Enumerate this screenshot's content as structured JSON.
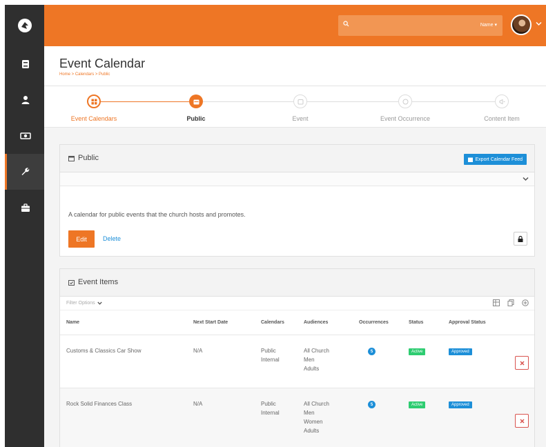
{
  "colors": {
    "brand": "#ee7625",
    "sidebar": "#2f2f2f",
    "link": "#1d8fd8",
    "active_badge": "#2ecc71",
    "approved_badge": "#1d8fd8",
    "danger": "#d9534f"
  },
  "sidebar": {
    "logo_icon": "rock-logo-icon",
    "items": [
      {
        "icon": "book-icon"
      },
      {
        "icon": "person-icon"
      },
      {
        "icon": "money-icon"
      },
      {
        "icon": "wrench-icon",
        "active": true
      },
      {
        "icon": "briefcase-icon"
      }
    ]
  },
  "header": {
    "search_icon": "search-icon",
    "search_scope": "Name ▾"
  },
  "page": {
    "title": "Event Calendar",
    "breadcrumb": "Home > Calendars > Public"
  },
  "wizard": {
    "steps": [
      {
        "label": "Event Calendars",
        "state": "completed",
        "icon": "calendars-icon"
      },
      {
        "label": "Public",
        "state": "current",
        "icon": "calendar-icon"
      },
      {
        "label": "Event",
        "state": "upcoming",
        "icon": "event-icon"
      },
      {
        "label": "Event Occurrence",
        "state": "upcoming",
        "icon": "occurrence-icon"
      },
      {
        "label": "Content Item",
        "state": "upcoming",
        "icon": "megaphone-icon"
      }
    ]
  },
  "calendar_panel": {
    "title": "Public",
    "export_label": "Export Calendar Feed",
    "description": "A calendar for public events that the church hosts and promotes.",
    "edit_label": "Edit",
    "delete_label": "Delete"
  },
  "event_items": {
    "title": "Event Items",
    "filter_label": "Filter Options",
    "columns": [
      "Name",
      "Next Start Date",
      "Calendars",
      "Audiences",
      "Occurrences",
      "Status",
      "Approval Status"
    ],
    "rows": [
      {
        "name": "Customs & Classics Car Show",
        "next_start": "N/A",
        "calendars": [
          "Public",
          "Internal"
        ],
        "audiences": [
          "All Church",
          "Men",
          "Adults"
        ],
        "occurrences": "5",
        "status": "Active",
        "approval": "Approved"
      },
      {
        "name": "Rock Solid Finances Class",
        "next_start": "N/A",
        "calendars": [
          "Public",
          "Internal"
        ],
        "audiences": [
          "All Church",
          "Men",
          "Women",
          "Adults"
        ],
        "occurrences": "5",
        "status": "Active",
        "approval": "Approved"
      }
    ]
  }
}
